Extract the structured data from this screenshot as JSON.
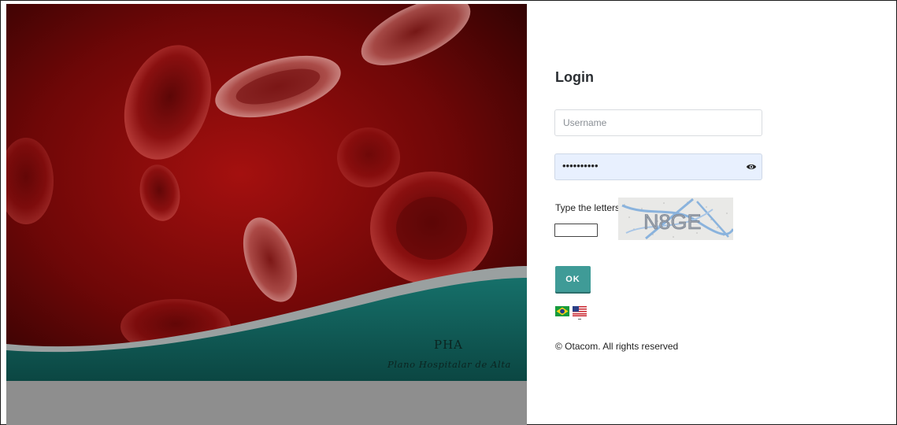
{
  "hero": {
    "title": "PHA",
    "subtitle": "Plano Hospitalar de Alta"
  },
  "login": {
    "title": "Login",
    "username_placeholder": "Username",
    "password_mask": "••••••••••",
    "show_password_icon": "eye-icon",
    "captcha_label": "Type the letters",
    "captcha_text": "N8GE",
    "ok_label": "OK"
  },
  "languages": [
    {
      "name": "brazil-flag-icon"
    },
    {
      "name": "usa-flag-icon"
    }
  ],
  "footer": {
    "copyright": "© Otacom. All rights reserved"
  },
  "colors": {
    "accent": "#3f9b97",
    "hero_red": "#8b0a0a",
    "hero_teal": "#0e5a55",
    "password_field_bg": "#e8f0fe"
  }
}
